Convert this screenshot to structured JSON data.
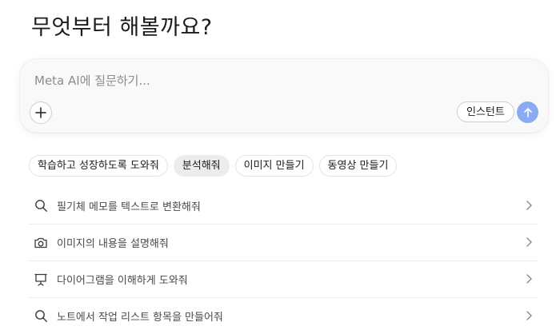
{
  "header": {
    "title": "무엇부터 해볼까요?"
  },
  "composer": {
    "placeholder": "Meta AI에 질문하기...",
    "instant_label": "인스턴트",
    "accent_color": "#8aaaf2"
  },
  "chips": [
    {
      "label": "학습하고 성장하도록 도와줘",
      "selected": false
    },
    {
      "label": "분석해줘",
      "selected": true
    },
    {
      "label": "이미지 만들기",
      "selected": false
    },
    {
      "label": "동영상 만들기",
      "selected": false
    }
  ],
  "suggestions": [
    {
      "icon": "search-icon",
      "label": "필기체 메모를 텍스트로 변환해줘"
    },
    {
      "icon": "camera-icon",
      "label": "이미지의 내용을 설명해줘"
    },
    {
      "icon": "presentation-icon",
      "label": "다이어그램을 이해하게 도와줘"
    },
    {
      "icon": "search-icon",
      "label": "노트에서 작업 리스트 항목을 만들어줘"
    }
  ]
}
